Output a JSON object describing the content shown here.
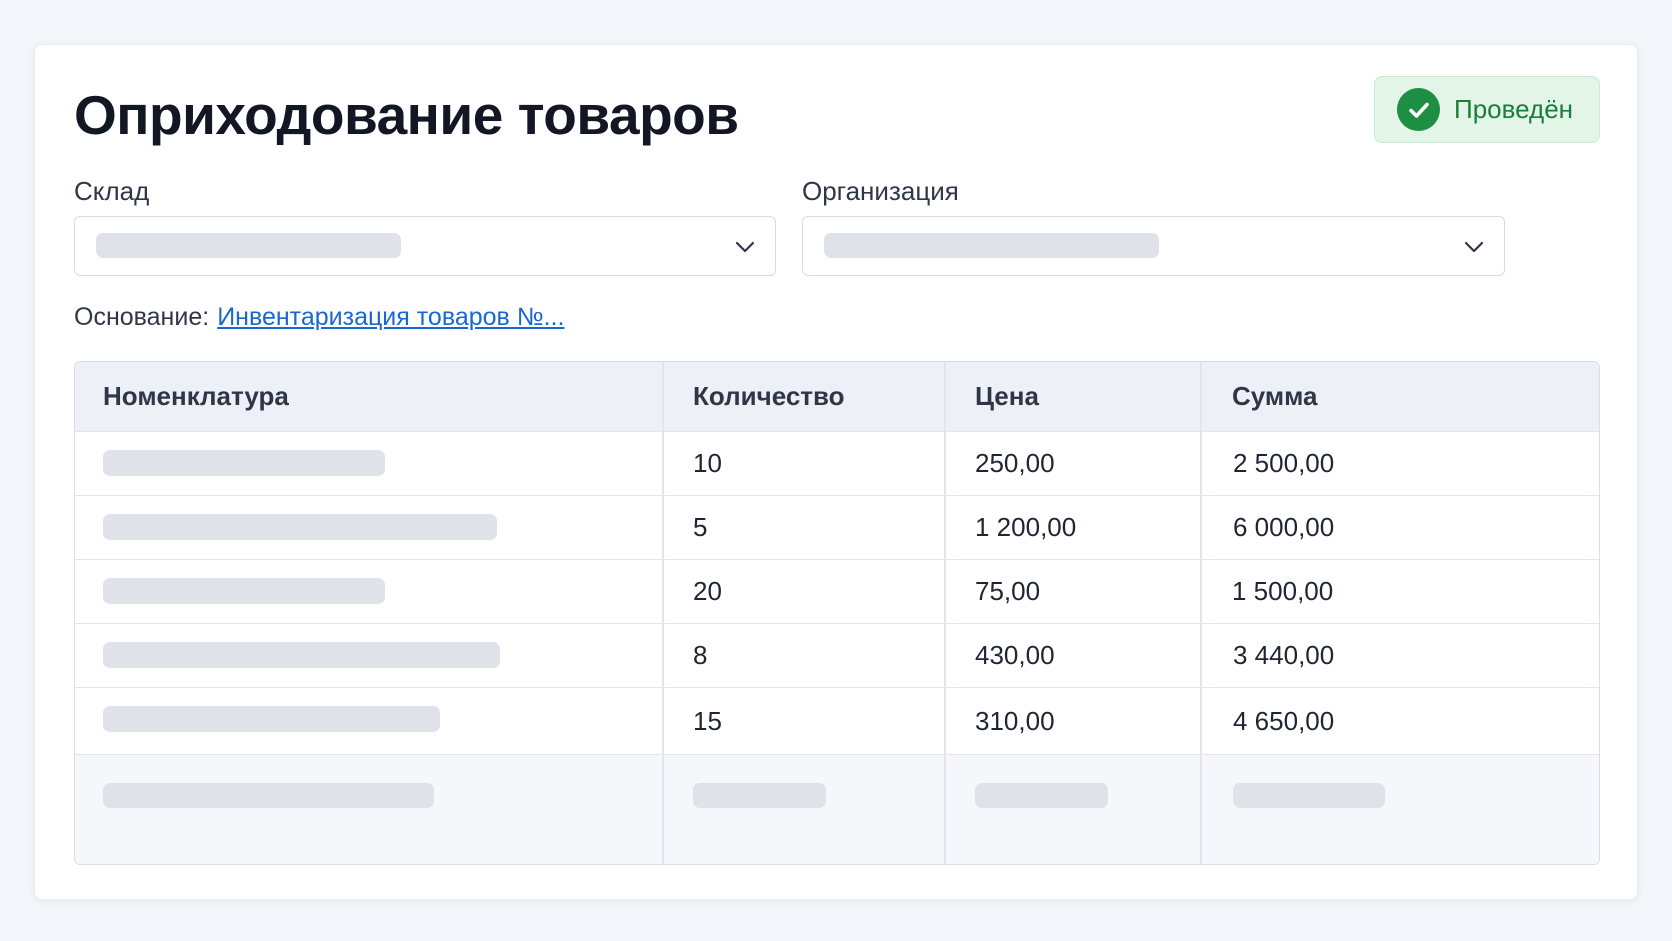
{
  "document": {
    "title": "Оприходование товаров",
    "status": "Проведён"
  },
  "fields": {
    "warehouse_label": "Склад",
    "organization_label": "Организация"
  },
  "basis": {
    "label": "Основание:",
    "link_text": "Инвентаризация товаров №..."
  },
  "table": {
    "headers": [
      "Номенклатура",
      "Количество",
      "Цена",
      "Сумма"
    ],
    "rows": [
      {
        "quantity": "10",
        "price": "250,00",
        "sum": "2 500,00"
      },
      {
        "quantity": "5",
        "price": "1 200,00",
        "sum": "6 000,00"
      },
      {
        "quantity": "20",
        "price": "75,00",
        "sum": "1 500,00"
      },
      {
        "quantity": "8",
        "price": "430,00",
        "sum": "3 440,00"
      },
      {
        "quantity": "15",
        "price": "310,00",
        "sum": "4 650,00"
      }
    ]
  },
  "colors": {
    "status_background": "#e3f5e7",
    "status_accent": "#1d8f43",
    "link": "#1967d2",
    "skeleton": "#dfe3e9"
  },
  "icons": {
    "status": "check-circle-icon",
    "dropdown": "chevron-down-icon"
  }
}
